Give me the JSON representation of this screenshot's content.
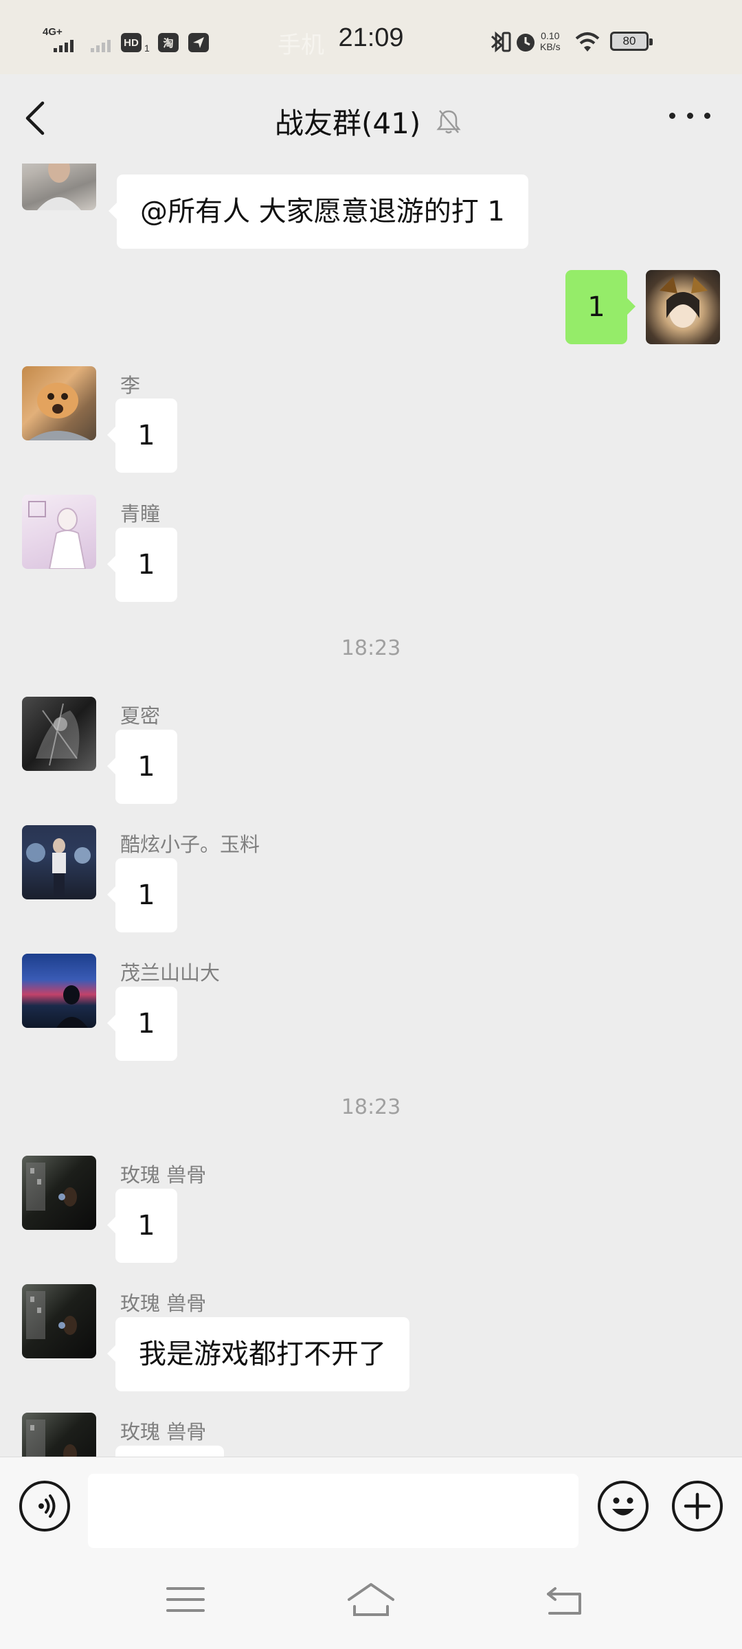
{
  "status_bar": {
    "network": "4G+",
    "hd_badge": "HD",
    "hd_sub": "1",
    "app_badge": "淘",
    "ghost_text": "手机",
    "time": "21:09",
    "speed_value": "0.10",
    "speed_unit": "KB/s",
    "battery": "80"
  },
  "header": {
    "title": "战友群(41)",
    "muted_icon": "bell-off-icon",
    "more_icon": "more-dots-icon",
    "back_icon": "back-chevron-icon"
  },
  "messages": [
    {
      "sender": "",
      "text": "@所有人   大家愿意退游的打 1"
    },
    {
      "sender": "me",
      "text": "1"
    },
    {
      "sender": "李",
      "text": "1"
    },
    {
      "sender": "青瞳",
      "text": "1"
    },
    {
      "timestamp": "18:23"
    },
    {
      "sender": "夏密",
      "text": "1"
    },
    {
      "sender": "酷炫小子。玉料",
      "text": "1"
    },
    {
      "sender": "茂兰山山大",
      "text": "1"
    },
    {
      "timestamp": "18:23"
    },
    {
      "sender": "玫瑰  兽骨",
      "text": "1"
    },
    {
      "sender": "玫瑰  兽骨",
      "text": "我是游戏都打不开了"
    },
    {
      "sender": "玫瑰  兽骨",
      "text": ""
    }
  ],
  "input_bar": {
    "voice_icon": "voice-icon",
    "emoji_icon": "emoji-icon",
    "plus_icon": "plus-icon",
    "text_value": ""
  },
  "nav_bar": {
    "menu_icon": "menu-icon",
    "home_icon": "home-icon",
    "back_icon": "back-icon"
  },
  "colors": {
    "chat_bg": "#ededed",
    "my_bubble": "#95ec69",
    "other_bubble": "#ffffff",
    "status_bar_bg": "#eeebe4"
  }
}
